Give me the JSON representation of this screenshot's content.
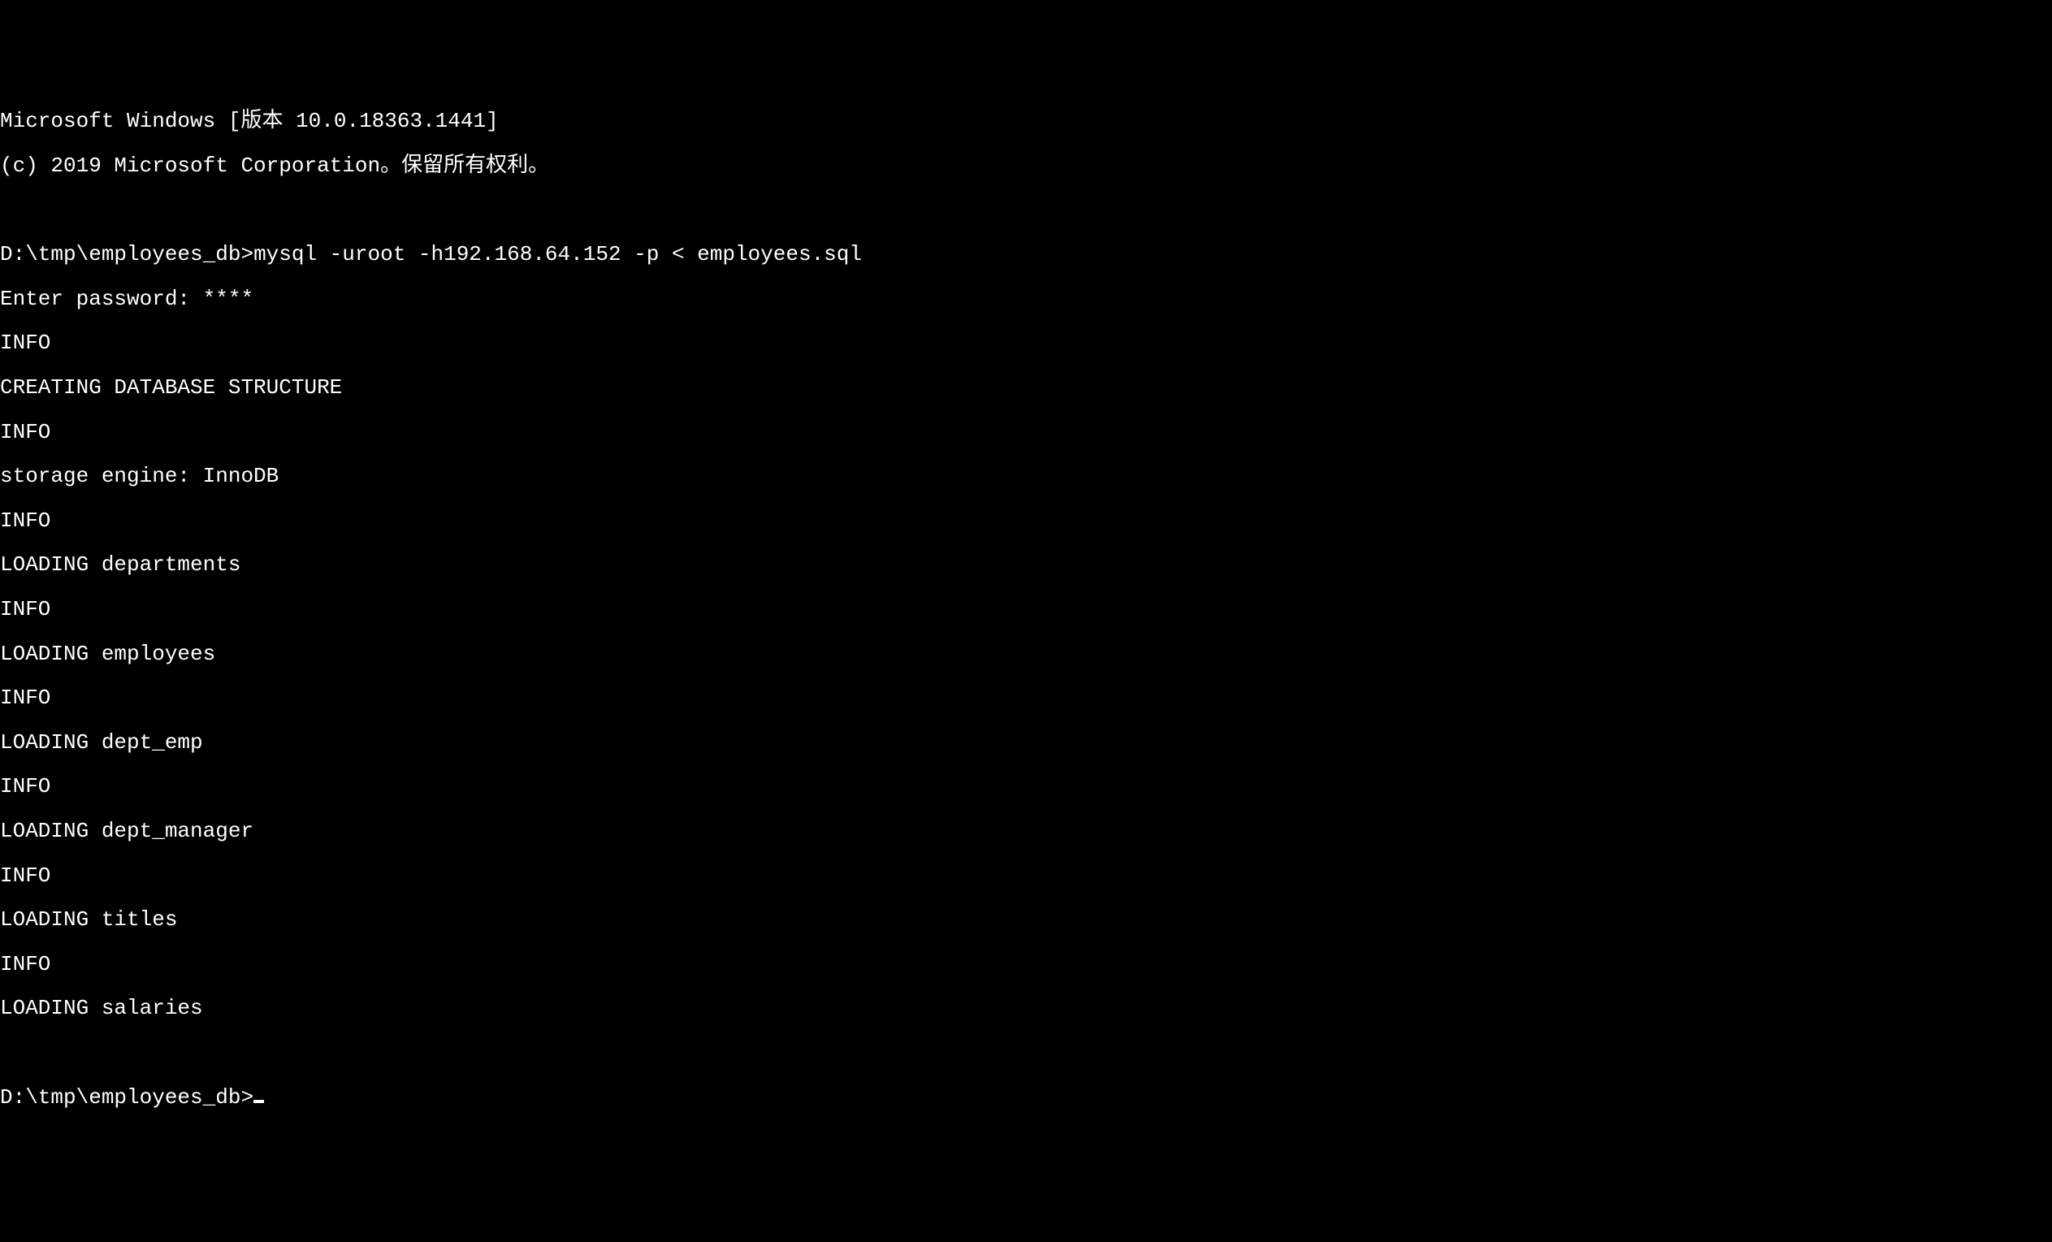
{
  "terminal": {
    "header_line1": "Microsoft Windows [版本 10.0.18363.1441]",
    "header_line2": "(c) 2019 Microsoft Corporation。保留所有权利。",
    "prompt1": "D:\\tmp\\employees_db>",
    "command1": "mysql -uroot -h192.168.64.152 -p < employees.sql",
    "password_prompt": "Enter password: ****",
    "output": [
      "INFO",
      "CREATING DATABASE STRUCTURE",
      "INFO",
      "storage engine: InnoDB",
      "INFO",
      "LOADING departments",
      "INFO",
      "LOADING employees",
      "INFO",
      "LOADING dept_emp",
      "INFO",
      "LOADING dept_manager",
      "INFO",
      "LOADING titles",
      "INFO",
      "LOADING salaries"
    ],
    "prompt2": "D:\\tmp\\employees_db>"
  }
}
